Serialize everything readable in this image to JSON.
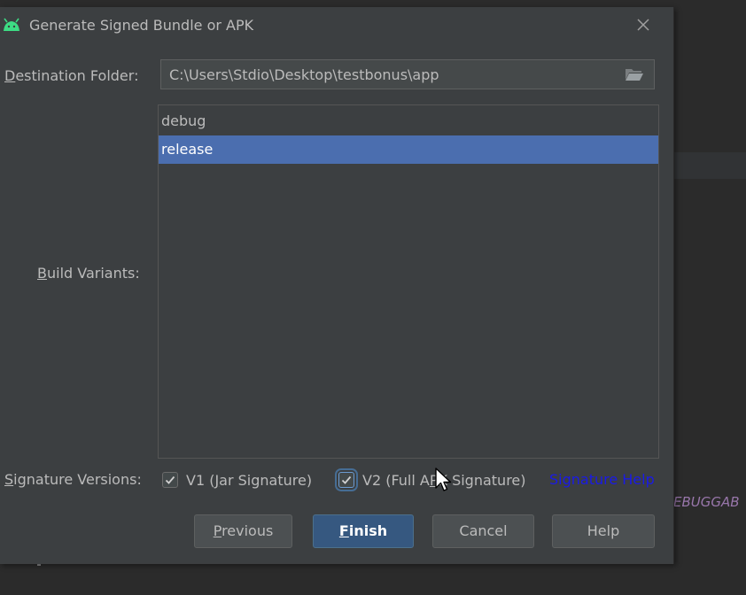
{
  "background": {
    "code_fragment": "EBUGGAB"
  },
  "dialog": {
    "title": "Generate Signed Bundle or APK",
    "close_icon": "close-icon",
    "destination": {
      "label_underlined": "D",
      "label_rest": "estination Folder:",
      "value": "C:\\Users\\Stdio\\Desktop\\testbonus\\app",
      "icon": "folder-open-icon"
    },
    "build_variants": {
      "label_underlined": "B",
      "label_rest": "uild Variants:",
      "items": [
        {
          "label": "debug",
          "selected": false
        },
        {
          "label": "release",
          "selected": true
        }
      ]
    },
    "signature_versions": {
      "label_underlined": "S",
      "label_rest": "ignature Versions:",
      "v1": {
        "label_before": "V1 (",
        "label_underlined": "J",
        "label_after": "ar Signature)",
        "checked": true
      },
      "v2": {
        "label_before": "V2 (Full A",
        "label_underlined": "P",
        "label_after": "K Signature)",
        "checked": true
      },
      "help_link": "Signature Help"
    },
    "buttons": {
      "previous": {
        "underlined": "P",
        "rest": "revious"
      },
      "finish": {
        "underlined": "F",
        "rest": "inish"
      },
      "cancel": "Cancel",
      "help": "Help"
    }
  },
  "colors": {
    "dialog_bg": "#3c3f41",
    "selection": "#4b6eaf",
    "primary_button": "#365880",
    "link": "#1a1ae6",
    "android_green": "#3ddc84"
  }
}
